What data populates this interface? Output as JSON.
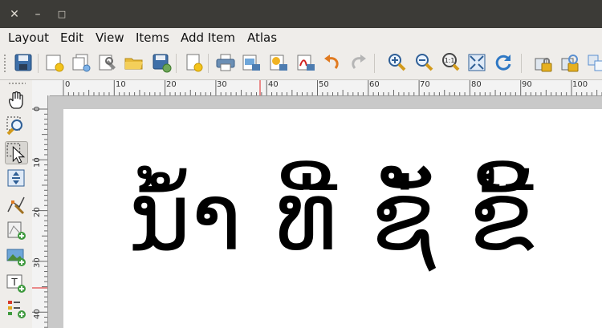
{
  "window": {
    "close_glyph": "✕",
    "minimize_glyph": "–",
    "maximize_glyph": "□"
  },
  "menu": [
    "Layout",
    "Edit",
    "View",
    "Items",
    "Add Item",
    "Atlas"
  ],
  "toolbar_icons": [
    "save-icon",
    "new-layout-icon",
    "duplicate-layout-icon",
    "layout-manager-icon",
    "open-template-icon",
    "save-as-template-icon",
    "add-pages-icon",
    "print-icon",
    "export-image-icon",
    "export-svg-icon",
    "export-pdf-icon",
    "undo-icon",
    "redo-icon",
    "zoom-in-icon",
    "zoom-out-icon",
    "zoom-actual-icon",
    "zoom-full-icon",
    "refresh-icon",
    "lock-items-icon",
    "unlock-items-icon",
    "group-icon"
  ],
  "side_tools": [
    "pan-icon",
    "zoom-tool-icon",
    "select-move-icon",
    "move-content-icon",
    "edit-nodes-icon",
    "add-map-icon",
    "add-picture-icon",
    "add-label-icon",
    "add-legend-icon"
  ],
  "ruler": {
    "x_labels": [
      "0",
      "10",
      "20",
      "30",
      "40",
      "50",
      "60",
      "70",
      "80",
      "90",
      "100"
    ],
    "y_labels": [
      "0",
      "10",
      "20",
      "30",
      "40"
    ]
  },
  "canvas_text": "ນ້ຳ ທີ່ ຊັ່ ຂີ້",
  "colors": {
    "titlebar": "#3c3b37",
    "menubar": "#efedea",
    "ruler_marker": "#e02020"
  }
}
